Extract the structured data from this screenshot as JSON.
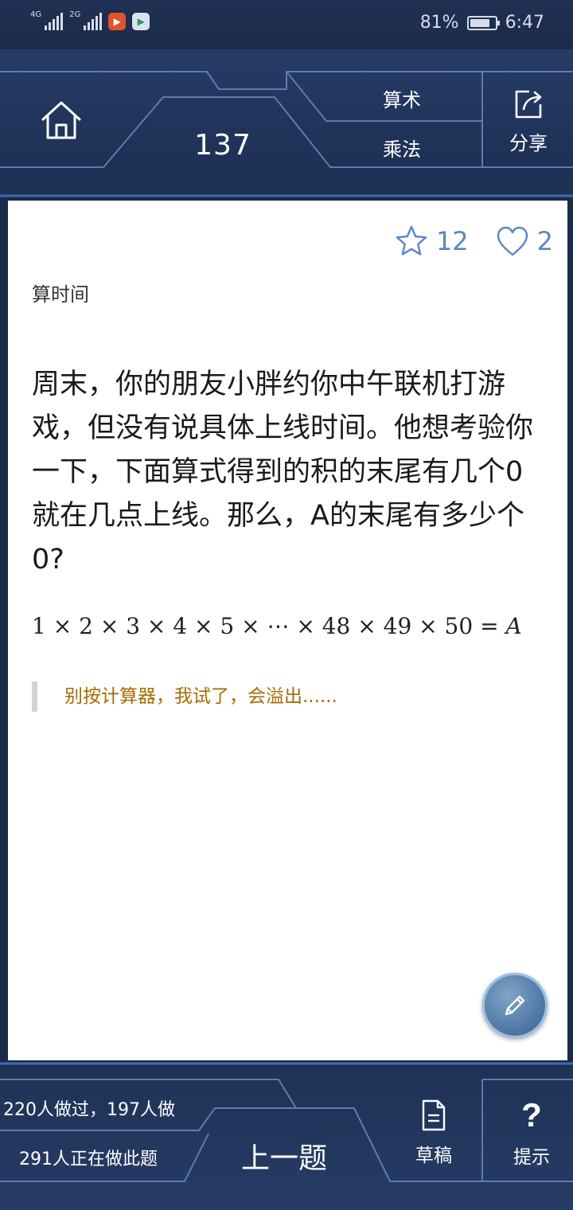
{
  "status_bar": {
    "network_1": "4G",
    "network_2": "2G",
    "battery": "81%",
    "battery_level": 0.81,
    "time": "6:47"
  },
  "header": {
    "question_number": "137",
    "tag_top": "算术",
    "tag_bottom": "乘法",
    "share_label": "分享"
  },
  "card": {
    "favorites": "12",
    "likes": "2",
    "category": "算时间",
    "question": "周末，你的朋友小胖约你中午联机打游戏，但没有说具体上线时间。他想考验你一下，下面算式得到的积的末尾有几个0就在几点上线。那么，A的末尾有多少个0?",
    "formula_terms": [
      "1",
      "2",
      "3",
      "4",
      "5",
      "⋯",
      "48",
      "49",
      "50"
    ],
    "formula_times": "×",
    "formula_equals": "=",
    "formula_result": "A",
    "quote": "别按计算器，我试了，会溢出......"
  },
  "bottom": {
    "done_info": "220人做过，197人做",
    "doing_info": "291人正在做此题",
    "prev_label": "上一题",
    "draft_label": "草稿",
    "hint_label": "提示",
    "hint_symbol": "?"
  },
  "colors": {
    "frame_dark": "#1c2b4b",
    "frame_line": "#5d7bb0",
    "stat_blue": "#5a86c7",
    "quote_text": "#a66a00"
  },
  "icons": [
    "home-icon",
    "share-icon",
    "star-icon",
    "heart-icon",
    "pencil-icon",
    "document-icon"
  ]
}
